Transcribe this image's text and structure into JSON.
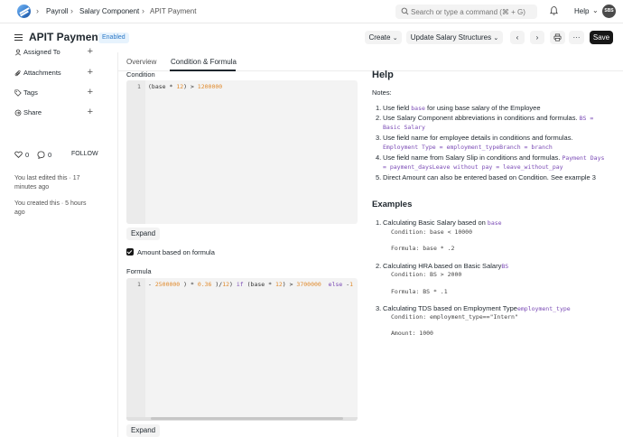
{
  "topbar": {
    "breadcrumbs": [
      "Payroll",
      "Salary Component",
      "APIT Payment"
    ],
    "search_placeholder": "Search or type a command (⌘ + G)",
    "help_label": "Help",
    "avatar_initials": "SBS"
  },
  "header": {
    "title": "APIT Payment",
    "status_badge": "Enabled",
    "create_label": "Create",
    "update_label": "Update Salary Structures",
    "more_label": "···",
    "save_label": "Save"
  },
  "sidebar": {
    "items": [
      {
        "label": "Assigned To",
        "icon": "user-icon"
      },
      {
        "label": "Attachments",
        "icon": "paperclip-icon"
      },
      {
        "label": "Tags",
        "icon": "tag-icon"
      },
      {
        "label": "Share",
        "icon": "share-icon"
      }
    ],
    "likes": "0",
    "comments": "0",
    "follow_label": "FOLLOW",
    "last_edited": "You last edited this · 17 minutes ago",
    "created": "You created this · 5 hours ago"
  },
  "tabs": [
    "Overview",
    "Condition & Formula"
  ],
  "condition": {
    "label": "Condition",
    "line_no": "1",
    "code": "(base * 12) > 1200000",
    "expand_label": "Expand"
  },
  "amount_based_on_formula": {
    "label": "Amount based on formula",
    "checked": true
  },
  "formula": {
    "label": "Formula",
    "line_no": "1",
    "code": "- 2500000 ) * 0.36 )/12) if (base * 12) > 3700000  else -1",
    "expand_label": "Expand"
  },
  "help": {
    "title": "Help",
    "notes_label": "Notes:",
    "notes": [
      {
        "text": "Use field ",
        "code": "base",
        "suffix": " for using base salary of the Employee"
      },
      {
        "text": "Use Salary Component abbreviations in conditions and formulas. ",
        "code": "BS = Basic Salary",
        "suffix": ""
      },
      {
        "text": "Use field name for employee details in conditions and formulas. ",
        "code": "Employment Type = employment_typeBranch = branch",
        "suffix": ""
      },
      {
        "text": "Use field name from Salary Slip in conditions and formulas. ",
        "code": "Payment Days = payment_daysLeave without pay = leave_without_pay",
        "suffix": ""
      },
      {
        "text": "Direct Amount can also be entered based on Condition. See example 3",
        "code": "",
        "suffix": ""
      }
    ],
    "examples_title": "Examples",
    "examples": [
      {
        "title": "Calculating Basic Salary based on ",
        "code": "base",
        "condition": "Condition: base < 10000",
        "second": "Formula: base * .2"
      },
      {
        "title": "Calculating HRA based on Basic Salary",
        "code": "BS",
        "condition": "Condition: BS > 2000",
        "second": "Formula: BS * .1"
      },
      {
        "title": "Calculating TDS based on Employment Type",
        "code": "employment_type",
        "condition": "Condition: employment_type==\"Intern\"",
        "second": "Amount: 1000"
      }
    ]
  }
}
